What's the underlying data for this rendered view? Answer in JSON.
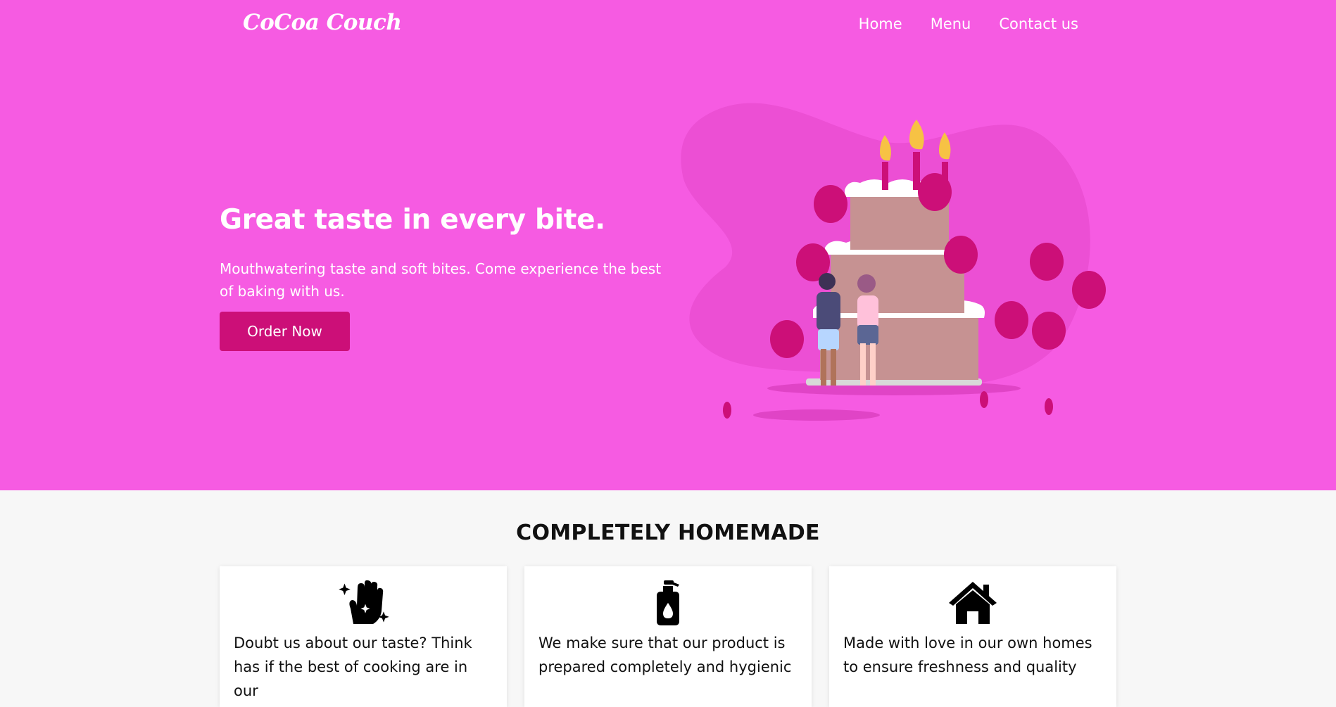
{
  "brand": "CoCoa Couch",
  "nav": {
    "home": "Home",
    "menu": "Menu",
    "contact": "Contact us"
  },
  "hero": {
    "title": "Great taste in every bite.",
    "subtitle": "Mouthwatering taste and soft bites. Come experience the best of baking with us.",
    "cta": "Order Now"
  },
  "features": {
    "title": "COMPLETELY HOMEMADE",
    "cards": [
      {
        "icon": "clean-hand-icon",
        "text": "Doubt us about our taste? Think has if the best of cooking are in our"
      },
      {
        "icon": "soap-dispenser-icon",
        "text": "We make sure that our product is prepared completely and hygienic"
      },
      {
        "icon": "home-icon",
        "text": "Made with love in our own homes to ensure freshness and quality"
      }
    ]
  },
  "colors": {
    "hero_bg": "#f65be2",
    "accent": "#cc0f78",
    "section_bg": "#f7f7f7"
  }
}
